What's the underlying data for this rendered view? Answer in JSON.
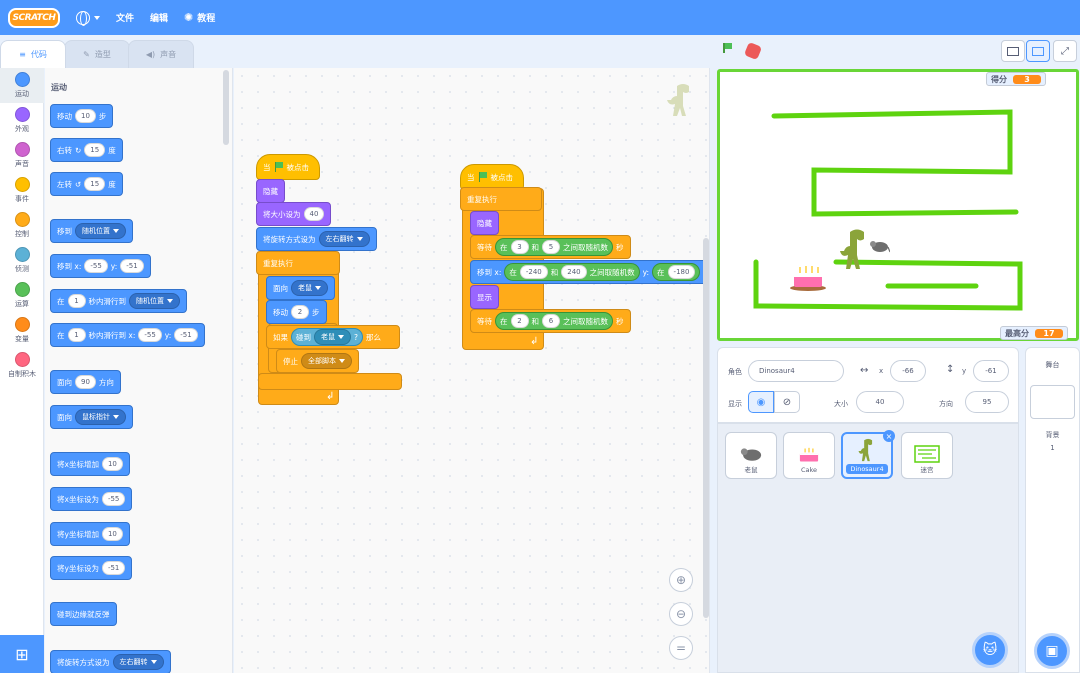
{
  "menubar": {
    "logo": "SCRATCH",
    "file": "文件",
    "edit": "编辑",
    "tutorials": "教程"
  },
  "tabs": [
    {
      "label": "代码"
    },
    {
      "label": "造型"
    },
    {
      "label": "声音"
    }
  ],
  "categories": [
    {
      "label": "运动",
      "color": "#4c97ff"
    },
    {
      "label": "外观",
      "color": "#9966ff"
    },
    {
      "label": "声音",
      "color": "#cf63cf"
    },
    {
      "label": "事件",
      "color": "#ffbf00"
    },
    {
      "label": "控制",
      "color": "#ffab19"
    },
    {
      "label": "侦测",
      "color": "#5cb1d6"
    },
    {
      "label": "运算",
      "color": "#59c059"
    },
    {
      "label": "变量",
      "color": "#ff8c1a"
    },
    {
      "label": "自制积木",
      "color": "#ff6680"
    }
  ],
  "palette": {
    "title": "运动",
    "move": {
      "pre": "移动",
      "val": "10",
      "post": "步"
    },
    "turn_right": {
      "pre": "右转",
      "val": "15",
      "post": "度"
    },
    "turn_left": {
      "pre": "左转",
      "val": "15",
      "post": "度"
    },
    "goto": {
      "pre": "移到",
      "dd": "随机位置"
    },
    "goto_xy": {
      "pre": "移到 x:",
      "x": "-55",
      "y_label": "y:",
      "y": "-51"
    },
    "glide": {
      "pre": "在",
      "val": "1",
      "mid": "秒内滑行到",
      "dd": "随机位置"
    },
    "glide_xy": {
      "pre": "在",
      "val": "1",
      "mid": "秒内滑行到 x:",
      "x": "-55",
      "y_label": "y:",
      "y": "-51"
    },
    "point_dir": {
      "pre": "面向",
      "val": "90",
      "post": "方向"
    },
    "point_towards": {
      "pre": "面向",
      "dd": "鼠标指针"
    },
    "change_x": {
      "pre": "将x坐标增加",
      "val": "10"
    },
    "set_x": {
      "pre": "将x坐标设为",
      "val": "-55"
    },
    "change_y": {
      "pre": "将y坐标增加",
      "val": "10"
    },
    "set_y": {
      "pre": "将y坐标设为",
      "val": "-51"
    },
    "bounce": {
      "pre": "碰到边缘就反弹"
    },
    "rotation": {
      "pre": "将旋转方式设为",
      "dd": "左右翻转"
    }
  },
  "script1": {
    "hat": {
      "pre": "当",
      "post": "被点击"
    },
    "hide": "隐藏",
    "set_size": {
      "pre": "将大小设为",
      "val": "40"
    },
    "set_rot": {
      "pre": "将旋转方式设为",
      "dd": "左右翻转"
    },
    "forever": "重复执行",
    "point": {
      "pre": "面向",
      "dd": "老鼠"
    },
    "move": {
      "pre": "移动",
      "val": "2",
      "post": "步"
    },
    "if": {
      "pre": "如果",
      "touch": "碰到",
      "dd": "老鼠",
      "q": "?",
      "post": "那么"
    },
    "stop": {
      "pre": "停止",
      "dd": "全部脚本"
    }
  },
  "script2": {
    "hat": {
      "pre": "当",
      "post": "被点击"
    },
    "forever": "重复执行",
    "hide": "隐藏",
    "wait1": {
      "pre": "等待",
      "in": "在",
      "a": "3",
      "and": "和",
      "b": "5",
      "mid": "之间取随机数",
      "post": "秒"
    },
    "goto": {
      "pre": "移到 x:",
      "in": "在",
      "a": "-240",
      "and": "和",
      "b": "240",
      "mid": "之间取随机数",
      "y": "y:",
      "in2": "在",
      "c": "-180"
    },
    "show": "显示",
    "wait2": {
      "pre": "等待",
      "in": "在",
      "a": "2",
      "and": "和",
      "b": "6",
      "mid": "之间取随机数",
      "post": "秒"
    }
  },
  "stage": {
    "score_label": "得分",
    "score": "3",
    "high_label": "最高分",
    "high": "17"
  },
  "sprite_info": {
    "sprite_label": "角色",
    "sprite_name": "Dinosaur4",
    "x_label": "x",
    "x": "-66",
    "y_label": "y",
    "y": "-61",
    "show_label": "显示",
    "size_label": "大小",
    "size": "40",
    "dir_label": "方向",
    "dir": "95"
  },
  "sprites": [
    {
      "name": "老鼠"
    },
    {
      "name": "Cake"
    },
    {
      "name": "Dinosaur4"
    },
    {
      "name": "迷宫"
    }
  ],
  "stage_panel": {
    "title": "舞台",
    "backdrop_label": "背景",
    "backdrop_count": "1"
  }
}
